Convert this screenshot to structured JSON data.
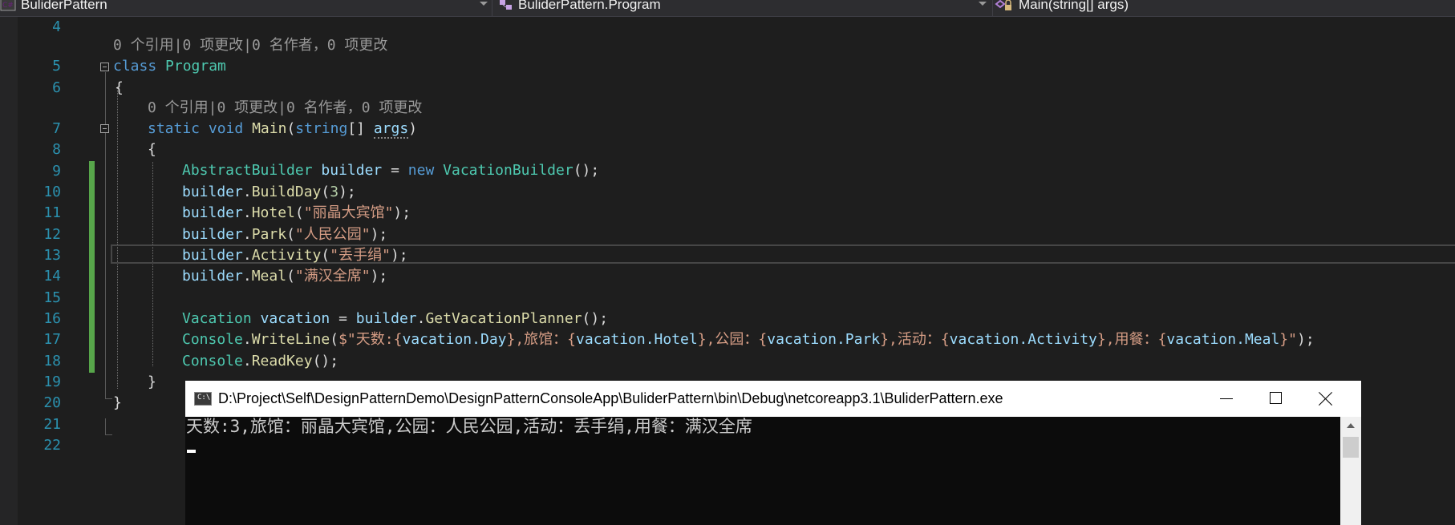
{
  "navbar": {
    "project": "BuliderPattern",
    "class": "BuliderPattern.Program",
    "member": "Main(string[] args)"
  },
  "editor": {
    "codelens_class": "0 个引用|0 项更改|0 名作者，0 项更改",
    "codelens_method": "0 个引用|0 项更改|0 名作者，0 项更改",
    "line_numbers": [
      "4",
      "5",
      "6",
      "7",
      "8",
      "9",
      "10",
      "11",
      "12",
      "13",
      "14",
      "15",
      "16",
      "17",
      "18",
      "19",
      "20",
      "21",
      "22"
    ],
    "code": {
      "l5_kw": "class",
      "l5_name": "Program",
      "open_brace": "{",
      "close_brace": "}",
      "l7_static": "static",
      "l7_void": "void",
      "l7_main": "Main",
      "l7_paren": "(",
      "l7_string": "string",
      "l7_arr": "[] ",
      "l7_args": "args",
      "l7_close": ")",
      "l9_type": "AbstractBuilder",
      "l9_var": "builder",
      "l9_eq": " = ",
      "l9_new": "new",
      "l9_ctor": "VacationBuilder",
      "l9_end": "();",
      "builder": "builder",
      "dot": ".",
      "l10_fn": "BuildDay",
      "l10_open": "(",
      "l10_num": "3",
      "l10_end": ");",
      "l11_fn": "Hotel",
      "l11_str": "\"丽晶大宾馆\"",
      "l12_fn": "Park",
      "l12_str": "\"人民公园\"",
      "l13_fn": "Activity",
      "l13_str": "\"丢手绢\"",
      "l14_fn": "Meal",
      "l14_str": "\"满汉全席\"",
      "paren_open": "(",
      "paren_close": ");",
      "l16_type": "Vacation",
      "l16_var": "vacation",
      "l16_fn": "GetVacationPlanner",
      "l16_end": "();",
      "console": "Console",
      "l17_fn": "WriteLine",
      "l17_s1": "$\"天数:{",
      "l17_p1": "vacation.Day",
      "l17_s2": "},旅馆：{",
      "l17_p2": "vacation.Hotel",
      "l17_s3": "},公园：{",
      "l17_p3": "vacation.Park",
      "l17_s4": "},活动：{",
      "l17_p4": "vacation.Activity",
      "l17_s5": "},用餐：{",
      "l17_p5": "vacation.Meal",
      "l17_s6": "}\"",
      "l17_end": ");",
      "l18_fn": "ReadKey",
      "l18_end": "();"
    }
  },
  "console_window": {
    "icon_label": "C:\\",
    "title": "D:\\Project\\Self\\DesignPatternDemo\\DesignPatternConsoleApp\\BuliderPattern\\bin\\Debug\\netcoreapp3.1\\BuliderPattern.exe",
    "output": "天数:3,旅馆：丽晶大宾馆,公园：人民公园,活动：丢手绢,用餐：满汉全席"
  },
  "colors": {
    "editor_bg": "#1e1e1e",
    "keyword": "#569cd6",
    "type": "#4ec9b0",
    "method": "#dcdcaa",
    "identifier": "#9cdcfe",
    "string": "#d69d85",
    "line_number": "#2b91af",
    "change_bar": "#57a64a"
  }
}
